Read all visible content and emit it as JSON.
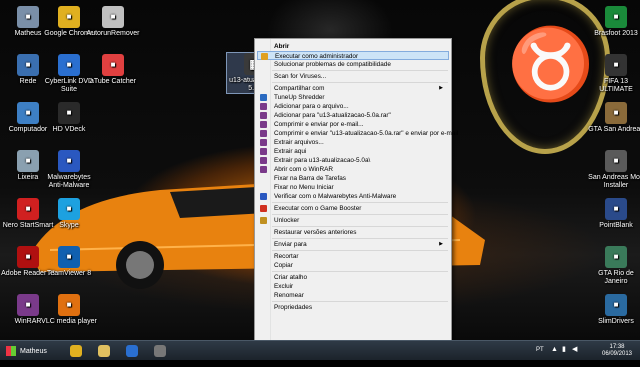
{
  "desktop_icons_left": [
    {
      "label": "Matheus",
      "icon": "user-folder-icon",
      "color": "#7a8fa8"
    },
    {
      "label": "Rede",
      "icon": "network-icon",
      "color": "#3a6fb0"
    },
    {
      "label": "Computador",
      "icon": "computer-icon",
      "color": "#3d7fc4"
    },
    {
      "label": "Lixeira",
      "icon": "recycle-bin-icon",
      "color": "#8aa0b0"
    },
    {
      "label": "Nero StartSmart",
      "icon": "nero-icon",
      "color": "#d02020"
    },
    {
      "label": "Adobe Reader XI",
      "icon": "adobe-reader-icon",
      "color": "#b01010"
    },
    {
      "label": "WinRAR",
      "icon": "winrar-icon",
      "color": "#7a3a8a"
    }
  ],
  "desktop_icons_col2": [
    {
      "label": "Google Chrome",
      "icon": "chrome-icon",
      "color": "#e0b020"
    },
    {
      "label": "CyberLink DVD Suite",
      "icon": "dvd-suite-icon",
      "color": "#2a6fd0"
    },
    {
      "label": "HD VDeck",
      "icon": "hd-vdeck-icon",
      "color": "#2a2a2a"
    },
    {
      "label": "Malwarebytes Anti-Malware",
      "icon": "malwarebytes-icon",
      "color": "#2a58c0"
    },
    {
      "label": "Skype",
      "icon": "skype-icon",
      "color": "#1da1e0"
    },
    {
      "label": "TeamViewer 8",
      "icon": "teamviewer-icon",
      "color": "#1060b0"
    },
    {
      "label": "VLC media player",
      "icon": "vlc-icon",
      "color": "#e07010"
    }
  ],
  "desktop_icons_col3": [
    {
      "label": "AutorunRemover",
      "icon": "autorun-remover-icon",
      "color": "#c0c0c0"
    },
    {
      "label": "aTube Catcher",
      "icon": "atube-catcher-icon",
      "color": "#e04040"
    }
  ],
  "selected_file": {
    "label": "u13-atualizacao-5.0a",
    "icon": "rar-archive-icon",
    "color": "#3a3a3a"
  },
  "desktop_icons_right": [
    {
      "label": "Brasfoot 2013",
      "icon": "brasfoot-icon",
      "color": "#1a8a3a"
    },
    {
      "label": "FIFA 13 ULTIMATE",
      "icon": "fifa-icon",
      "color": "#333333"
    },
    {
      "label": "GTA San Andreas",
      "icon": "gta-sa-icon",
      "color": "#8a6a3a"
    },
    {
      "label": "San Andreas Mod Installer",
      "icon": "sa-mod-installer-icon",
      "color": "#5a5a5a"
    },
    {
      "label": "PointBlank",
      "icon": "pointblank-icon",
      "color": "#2a4a8a"
    },
    {
      "label": "GTA Rio de Janeiro",
      "icon": "gta-rio-icon",
      "color": "#3a7a5a"
    },
    {
      "label": "SlimDrivers",
      "icon": "slimdrivers-icon",
      "color": "#2a6aa0"
    }
  ],
  "context_menu": {
    "items": [
      {
        "label": "Abrir",
        "bold": true,
        "icon": ""
      },
      {
        "label": "Executar como administrador",
        "icon": "shield-icon",
        "icon_color": "#e0a020",
        "highlight": true
      },
      {
        "label": "Solucionar problemas de compatibilidade",
        "icon": ""
      },
      {
        "sep": true
      },
      {
        "label": "Scan for Viruses...",
        "icon": ""
      },
      {
        "sep": true
      },
      {
        "label": "Compartilhar com",
        "icon": "",
        "submenu": true
      },
      {
        "label": "TuneUp Shredder",
        "icon": "tuneup-icon",
        "icon_color": "#2a6ac0"
      },
      {
        "label": "Adicionar para o arquivo...",
        "icon": "winrar-icon",
        "icon_color": "#7a3a8a"
      },
      {
        "label": "Adicionar para \"u13-atualizacao-5.0a.rar\"",
        "icon": "winrar-icon",
        "icon_color": "#7a3a8a"
      },
      {
        "label": "Comprimir e enviar por e-mail...",
        "icon": "winrar-icon",
        "icon_color": "#7a3a8a"
      },
      {
        "label": "Comprimir e enviar \"u13-atualizacao-5.0a.rar\" e enviar por e-mail",
        "icon": "winrar-icon",
        "icon_color": "#7a3a8a"
      },
      {
        "label": "Extrair arquivos...",
        "icon": "winrar-icon",
        "icon_color": "#7a3a8a"
      },
      {
        "label": "Extrair aqui",
        "icon": "winrar-icon",
        "icon_color": "#7a3a8a"
      },
      {
        "label": "Extrair para u13-atualizacao-5.0a\\",
        "icon": "winrar-icon",
        "icon_color": "#7a3a8a"
      },
      {
        "label": "Abrir com o WinRAR",
        "icon": "winrar-icon",
        "icon_color": "#7a3a8a"
      },
      {
        "label": "Fixar na Barra de Tarefas",
        "icon": ""
      },
      {
        "label": "Fixar no Menu Iniciar",
        "icon": ""
      },
      {
        "label": "Verificar com o Malwarebytes Anti-Malware",
        "icon": "malwarebytes-icon",
        "icon_color": "#2a58c0"
      },
      {
        "sep": true
      },
      {
        "label": "Executar com o Game Booster",
        "icon": "game-booster-icon",
        "icon_color": "#d03020"
      },
      {
        "sep": true
      },
      {
        "label": "Unlocker",
        "icon": "unlocker-icon",
        "icon_color": "#c09020"
      },
      {
        "sep": true
      },
      {
        "label": "Restaurar versões anteriores",
        "icon": ""
      },
      {
        "sep": true
      },
      {
        "label": "Enviar para",
        "icon": "",
        "submenu": true
      },
      {
        "sep": true
      },
      {
        "label": "Recortar",
        "icon": ""
      },
      {
        "label": "Copiar",
        "icon": ""
      },
      {
        "sep": true
      },
      {
        "label": "Criar atalho",
        "icon": ""
      },
      {
        "label": "Excluir",
        "icon": ""
      },
      {
        "label": "Renomear",
        "icon": ""
      },
      {
        "sep": true
      },
      {
        "label": "Propriedades",
        "icon": ""
      }
    ]
  },
  "taskbar": {
    "start_label": "Matheus",
    "pinned": [
      {
        "icon": "chrome-taskbar-icon",
        "color": "#e0b020"
      },
      {
        "icon": "explorer-taskbar-icon",
        "color": "#e0c060"
      },
      {
        "icon": "media-player-taskbar-icon",
        "color": "#2a6fd0"
      },
      {
        "icon": "camera-taskbar-icon",
        "color": "#777777"
      }
    ],
    "language": "PT",
    "time": "17:38",
    "date": "06/09/2013"
  }
}
